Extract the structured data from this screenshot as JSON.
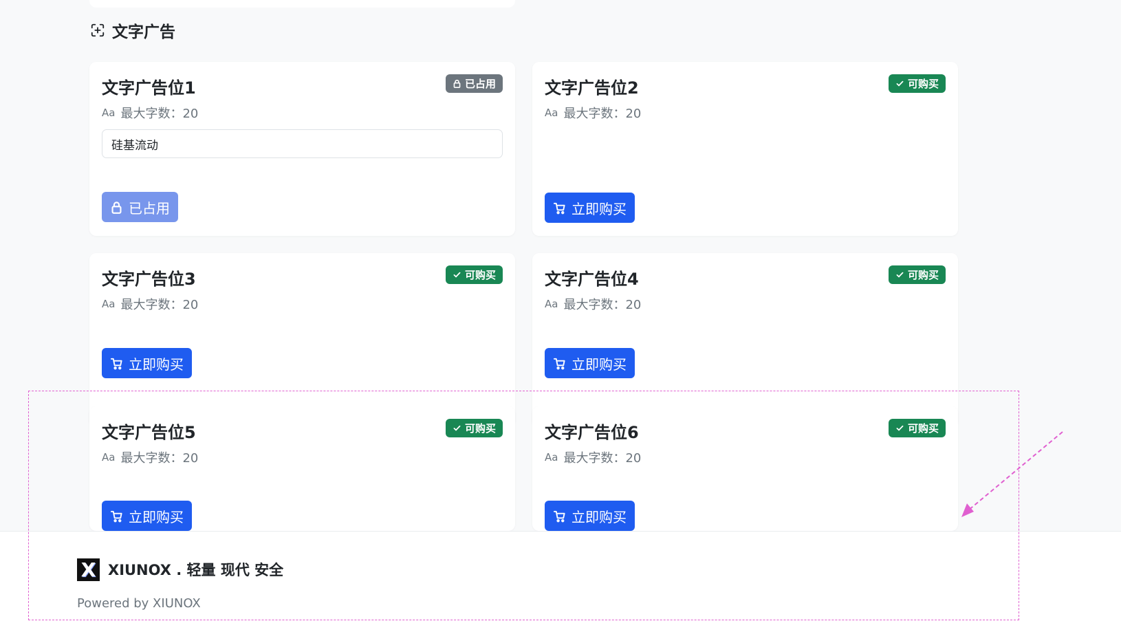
{
  "section": {
    "icon": "scan-text-icon",
    "title": "文字广告"
  },
  "cards": [
    {
      "title": "文字广告位1",
      "status": "taken",
      "badge": "已占用",
      "max_chars": "最大字数：20",
      "content": "硅基流动",
      "button": "已占用"
    },
    {
      "title": "文字广告位2",
      "status": "available",
      "badge": "可购买",
      "max_chars": "最大字数：20",
      "button": "立即购买"
    },
    {
      "title": "文字广告位3",
      "status": "available",
      "badge": "可购买",
      "max_chars": "最大字数：20",
      "button": "立即购买"
    },
    {
      "title": "文字广告位4",
      "status": "available",
      "badge": "可购买",
      "max_chars": "最大字数：20",
      "button": "立即购买"
    },
    {
      "title": "文字广告位5",
      "status": "available",
      "badge": "可购买",
      "max_chars": "最大字数：20",
      "button": "立即购买"
    },
    {
      "title": "文字广告位6",
      "status": "available",
      "badge": "可购买",
      "max_chars": "最大字数：20",
      "button": "立即购买"
    }
  ],
  "footer": {
    "logo_letter": "X",
    "brand": "XIUNOX . 轻量 现代 安全",
    "powered": "Powered by XIUNOX"
  },
  "colors": {
    "primary": "#1f5cf0",
    "success": "#198754",
    "secondary": "#6c757d",
    "annotation": "#e060d0"
  }
}
